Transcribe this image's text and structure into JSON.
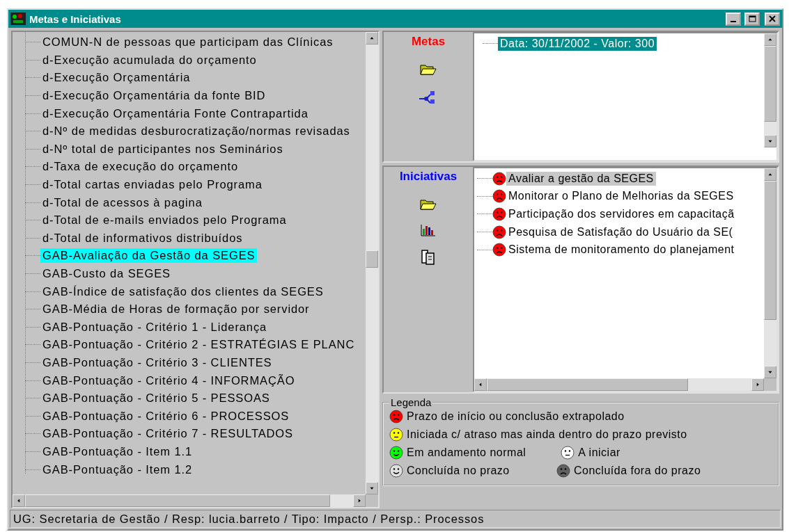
{
  "window": {
    "title": "Metas e Iniciativas"
  },
  "indicator_tree": {
    "items": [
      {
        "label": "COMUN-N de pessoas que participam das Clínicas",
        "selected": false
      },
      {
        "label": "d-Execução acumulada do orçamento",
        "selected": false
      },
      {
        "label": "d-Execução Orçamentária",
        "selected": false
      },
      {
        "label": "d-Execução Orçamentária da fonte BID",
        "selected": false
      },
      {
        "label": "d-Execução Orçamentária Fonte Contrapartida",
        "selected": false
      },
      {
        "label": "d-Nº de medidas desburocratização/normas revisadas",
        "selected": false
      },
      {
        "label": "d-Nº total de participantes nos Seminários",
        "selected": false
      },
      {
        "label": "d-Taxa de execução do orçamento",
        "selected": false
      },
      {
        "label": "d-Total cartas enviadas pelo Programa",
        "selected": false
      },
      {
        "label": "d-Total de acessos à pagina",
        "selected": false
      },
      {
        "label": "d-Total de e-mails enviados pelo Programa",
        "selected": false
      },
      {
        "label": "d-Total de informativos distribuídos",
        "selected": false
      },
      {
        "label": "GAB-Avaliação da Gestão da SEGES",
        "selected": true
      },
      {
        "label": "GAB-Custo da SEGES",
        "selected": false
      },
      {
        "label": "GAB-Índice de satisfação dos clientes da SEGES",
        "selected": false
      },
      {
        "label": "GAB-Média de Horas de formação por servidor",
        "selected": false
      },
      {
        "label": "GAB-Pontuação - Critério 1 - Liderança",
        "selected": false
      },
      {
        "label": "GAB-Pontuação - Critério 2 - ESTRATÉGIAS E PLANC",
        "selected": false
      },
      {
        "label": "GAB-Pontuação - Critério 3 - CLIENTES",
        "selected": false
      },
      {
        "label": "GAB-Pontuação - Critério 4 - INFORMAÇÃO",
        "selected": false
      },
      {
        "label": "GAB-Pontuação - Critério 5 - PESSOAS",
        "selected": false
      },
      {
        "label": "GAB-Pontuação - Critério 6 - PROCESSOS",
        "selected": false
      },
      {
        "label": "GAB-Pontuação - Critério 7 - RESULTADOS",
        "selected": false
      },
      {
        "label": "GAB-Pontuação - Item 1.1",
        "selected": false
      },
      {
        "label": "GAB-Pontuação - Item 1.2",
        "selected": false
      }
    ]
  },
  "metas": {
    "heading": "Metas",
    "items": [
      {
        "label": "Data: 30/11/2002 - Valor: 300",
        "selected": true
      }
    ]
  },
  "iniciativas": {
    "heading": "Iniciativas",
    "items": [
      {
        "label": "Avaliar a gestão da SEGES",
        "selected": true,
        "color": "#ff0000",
        "kind": "sad"
      },
      {
        "label": "Monitorar o Plano de Melhorias da SEGES",
        "selected": false,
        "color": "#ff0000",
        "kind": "sad"
      },
      {
        "label": "Participação dos servidores em capacitaçã",
        "selected": false,
        "color": "#ff0000",
        "kind": "sad"
      },
      {
        "label": "Pesquisa de Satisfação do Usuário da SE(",
        "selected": false,
        "color": "#ff0000",
        "kind": "sad"
      },
      {
        "label": "Sistema de monitoramento do planejament",
        "selected": false,
        "color": "#ff0000",
        "kind": "sad"
      }
    ]
  },
  "legend": {
    "title": "Legenda",
    "items": [
      {
        "label": "Prazo de início ou conclusão extrapolado",
        "color": "#ff0000",
        "kind": "sad"
      },
      {
        "label": "Iniciada c/ atraso mas ainda dentro do prazo previsto",
        "color": "#ffff00",
        "kind": "neutral"
      },
      {
        "label": "Em andamento normal",
        "color": "#00ff00",
        "kind": "happy"
      },
      {
        "label": "A iniciar",
        "color": "#ffffff",
        "kind": "neutral"
      },
      {
        "label": "Concluída no prazo",
        "color": "#e0e0e0",
        "kind": "happy"
      },
      {
        "label": "Concluída fora do prazo",
        "color": "#606060",
        "kind": "sad"
      }
    ]
  },
  "status_bar": "UG: Secretaria de Gestão / Resp: lucia.barreto / Tipo: Impacto / Persp.: Processos"
}
